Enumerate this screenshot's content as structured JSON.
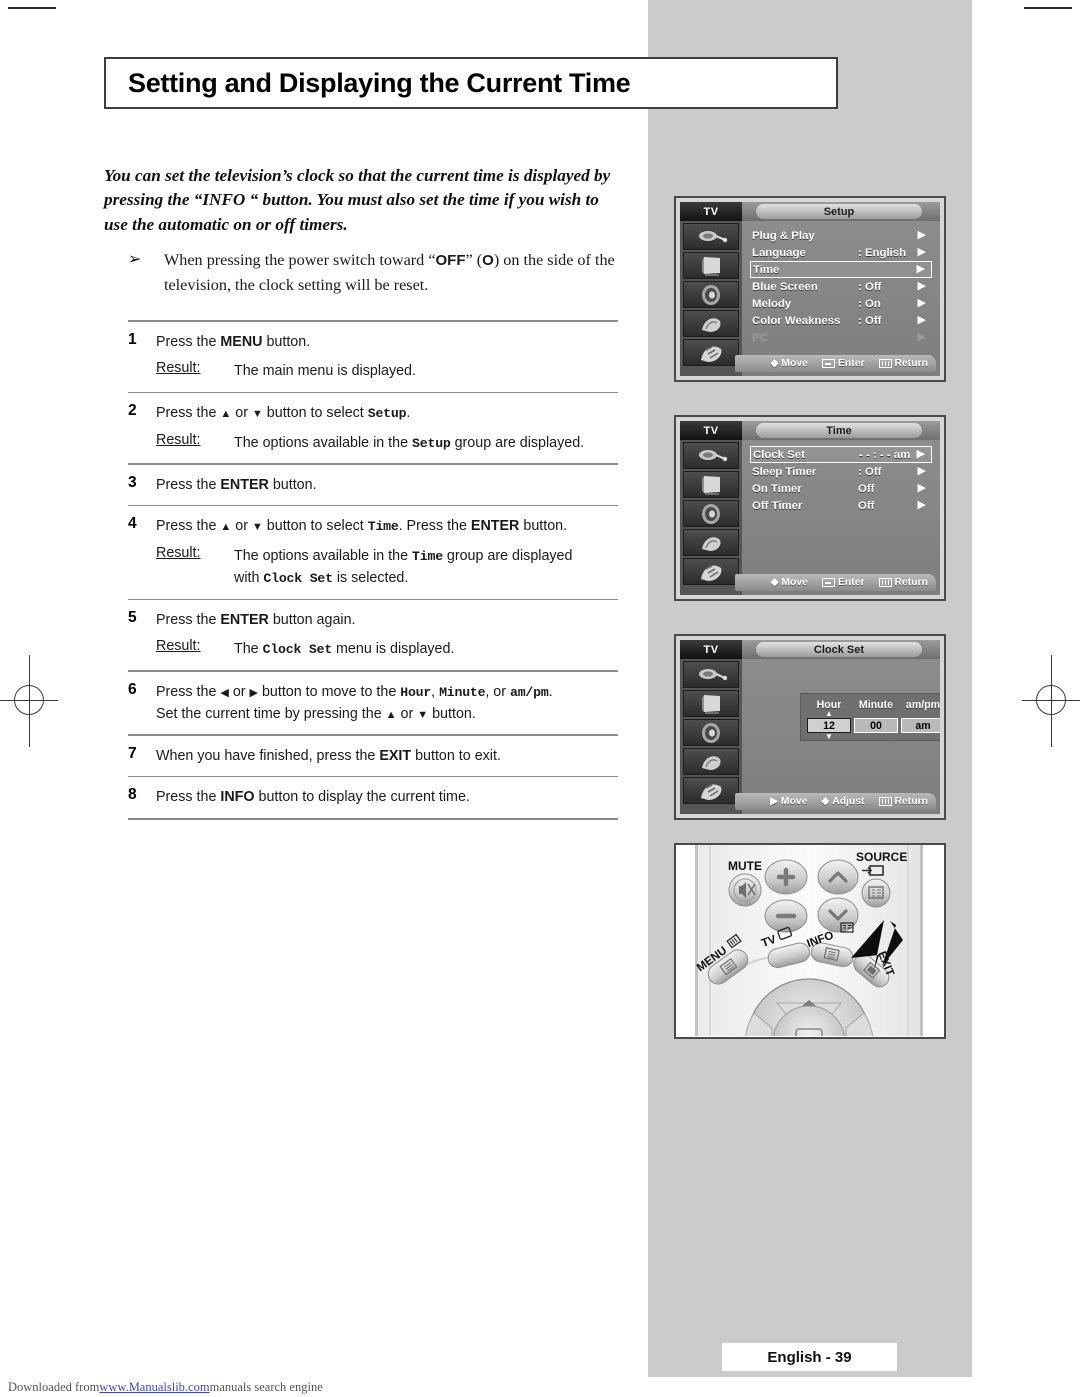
{
  "page": {
    "title": "Setting and Displaying the Current Time",
    "footer_page": "English - 39",
    "download_prefix": "Downloaded from ",
    "download_link": "www.Manualslib.com",
    "download_suffix": " manuals search engine"
  },
  "intro": "You can set the television’s clock so that the current time is displayed by pressing the “INFO “ button. You must also set the time if you wish to use the automatic on or off timers.",
  "note": {
    "arrow": "➢",
    "text_1": "When pressing the power switch toward “",
    "bold_1": "OFF",
    "text_2": "” (",
    "bold_2": "O",
    "text_3": ") on the side of the television, the clock setting will be reset."
  },
  "steps": [
    {
      "num": "1",
      "line": "Press the MENU button.",
      "result_label": "Result:",
      "result": "The main menu is displayed."
    },
    {
      "num": "2",
      "line": "Press the ▲ or ▼ button to select Setup.",
      "result_label": "Result:",
      "result": "The options available in the Setup group are displayed."
    },
    {
      "num": "3",
      "line": "Press the ENTER button."
    },
    {
      "num": "4",
      "line": "Press the ▲ or ▼ button to select Time. Press the ENTER button.",
      "result_label": "Result:",
      "result": "The options available in the Time group are displayed with Clock Set is selected."
    },
    {
      "num": "5",
      "line": "Press the ENTER button again.",
      "result_label": "Result:",
      "result": "The Clock Set menu is displayed."
    },
    {
      "num": "6",
      "line": "Press the ◄ or ► button to move to the Hour, Minute, or am/pm. Set the current time by pressing the ▲ or ▼ button."
    },
    {
      "num": "7",
      "line": "When you have finished, press the EXIT button to exit."
    },
    {
      "num": "8",
      "line": "Press the INFO button to display the current time."
    }
  ],
  "osd_setup": {
    "tv_label": "TV",
    "title": "Setup",
    "rows": [
      {
        "label": "Plug & Play",
        "value": "",
        "arrow": "▶",
        "selected": false,
        "dim": false
      },
      {
        "label": "Language",
        "value": ": English",
        "arrow": "▶",
        "selected": false,
        "dim": false
      },
      {
        "label": "Time",
        "value": "",
        "arrow": "▶",
        "selected": true,
        "dim": false
      },
      {
        "label": "Blue Screen",
        "value": ": Off",
        "arrow": "▶",
        "selected": false,
        "dim": false
      },
      {
        "label": "Melody",
        "value": ": On",
        "arrow": "▶",
        "selected": false,
        "dim": false
      },
      {
        "label": "Color Weakness",
        "value": ": Off",
        "arrow": "▶",
        "selected": false,
        "dim": false
      },
      {
        "label": "PC",
        "value": "",
        "arrow": "▶",
        "selected": false,
        "dim": true
      }
    ],
    "footer": [
      {
        "icon": "updown-icon",
        "label": "Move"
      },
      {
        "icon": "enter-icon",
        "label": "Enter"
      },
      {
        "icon": "menu-bars-icon",
        "label": "Return"
      }
    ]
  },
  "osd_time": {
    "tv_label": "TV",
    "title": "Time",
    "rows": [
      {
        "label": "Clock Set",
        "value": "- - : - -  am",
        "arrow": "▶",
        "selected": true,
        "dim": false
      },
      {
        "label": "Sleep Timer",
        "value": ": Off",
        "arrow": "▶",
        "selected": false,
        "dim": false
      },
      {
        "label": "On Timer",
        "value": "Off",
        "arrow": "▶",
        "selected": false,
        "dim": false
      },
      {
        "label": "Off Timer",
        "value": "Off",
        "arrow": "▶",
        "selected": false,
        "dim": false
      }
    ],
    "footer": [
      {
        "icon": "updown-icon",
        "label": "Move"
      },
      {
        "icon": "enter-icon",
        "label": "Enter"
      },
      {
        "icon": "menu-bars-icon",
        "label": "Return"
      }
    ]
  },
  "osd_clockset": {
    "tv_label": "TV",
    "title": "Clock Set",
    "headers": [
      "Hour",
      "Minute",
      "am/pm"
    ],
    "values": [
      "12",
      "00",
      "am"
    ],
    "active_index": 0,
    "footer": [
      {
        "icon": "right-arrow-icon",
        "label": "Move"
      },
      {
        "icon": "updown-icon",
        "label": "Adjust"
      },
      {
        "icon": "menu-bars-icon",
        "label": "Return"
      }
    ]
  },
  "remote": {
    "mute": "MUTE",
    "source": "SOURCE",
    "menu": "MENU",
    "tv": "TV",
    "info": "INFO",
    "exit": "EXIT",
    "volume_plus": "+",
    "volume_minus": "–"
  }
}
